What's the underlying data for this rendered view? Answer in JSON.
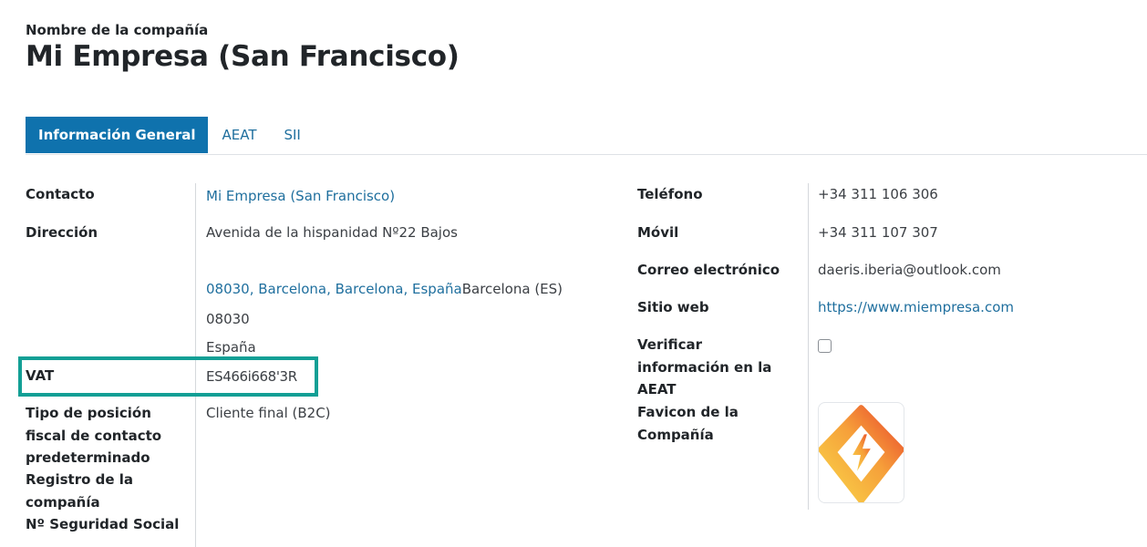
{
  "header": {
    "label": "Nombre de la compañía",
    "company_name": "Mi Empresa (San Francisco)"
  },
  "tabs": [
    {
      "label": "Información General",
      "active": true
    },
    {
      "label": "AEAT",
      "active": false
    },
    {
      "label": "SII",
      "active": false
    }
  ],
  "left": {
    "contacto_label": "Contacto",
    "contacto_value": "Mi Empresa (San Francisco)",
    "direccion_label": "Dirección",
    "direccion_street": "Avenida de la hispanidad Nº22 Bajos",
    "direccion_city_link": "08030, Barcelona, Barcelona, España",
    "direccion_state": "Barcelona (ES)",
    "direccion_zip": "08030",
    "direccion_country": "España",
    "vat_label": "VAT",
    "vat_value": "ES466i668'3R",
    "tipo_label_1": "Tipo de posición",
    "tipo_label_2": "fiscal de contacto",
    "tipo_label_3": "predeterminado",
    "tipo_value": "Cliente final (B2C)",
    "registro_label_1": "Registro de la",
    "registro_label_2": "compañía",
    "seguridad_label": "Nº Seguridad Social"
  },
  "right": {
    "telefono_label": "Teléfono",
    "telefono_value": "+34 311 106 306",
    "movil_label": "Móvil",
    "movil_value": "+34 311 107 307",
    "correo_label": "Correo electrónico",
    "correo_value": "daeris.iberia@outlook.com",
    "web_label": "Sitio web",
    "web_value": "https://www.miempresa.com",
    "verificar_label_1": "Verificar",
    "verificar_label_2": "información en la",
    "verificar_label_3": "AEAT",
    "verificar_checked": false,
    "favicon_label_1": "Favicon de la",
    "favicon_label_2": "Compañía",
    "favicon_icon": "lightning-bolt-icon"
  },
  "colors": {
    "accent": "#0f72ad",
    "link": "#1f6f9e",
    "highlight": "#129f95",
    "favicon_gradient": [
      "#f9d84a",
      "#f47a2a",
      "#e8452b"
    ]
  }
}
